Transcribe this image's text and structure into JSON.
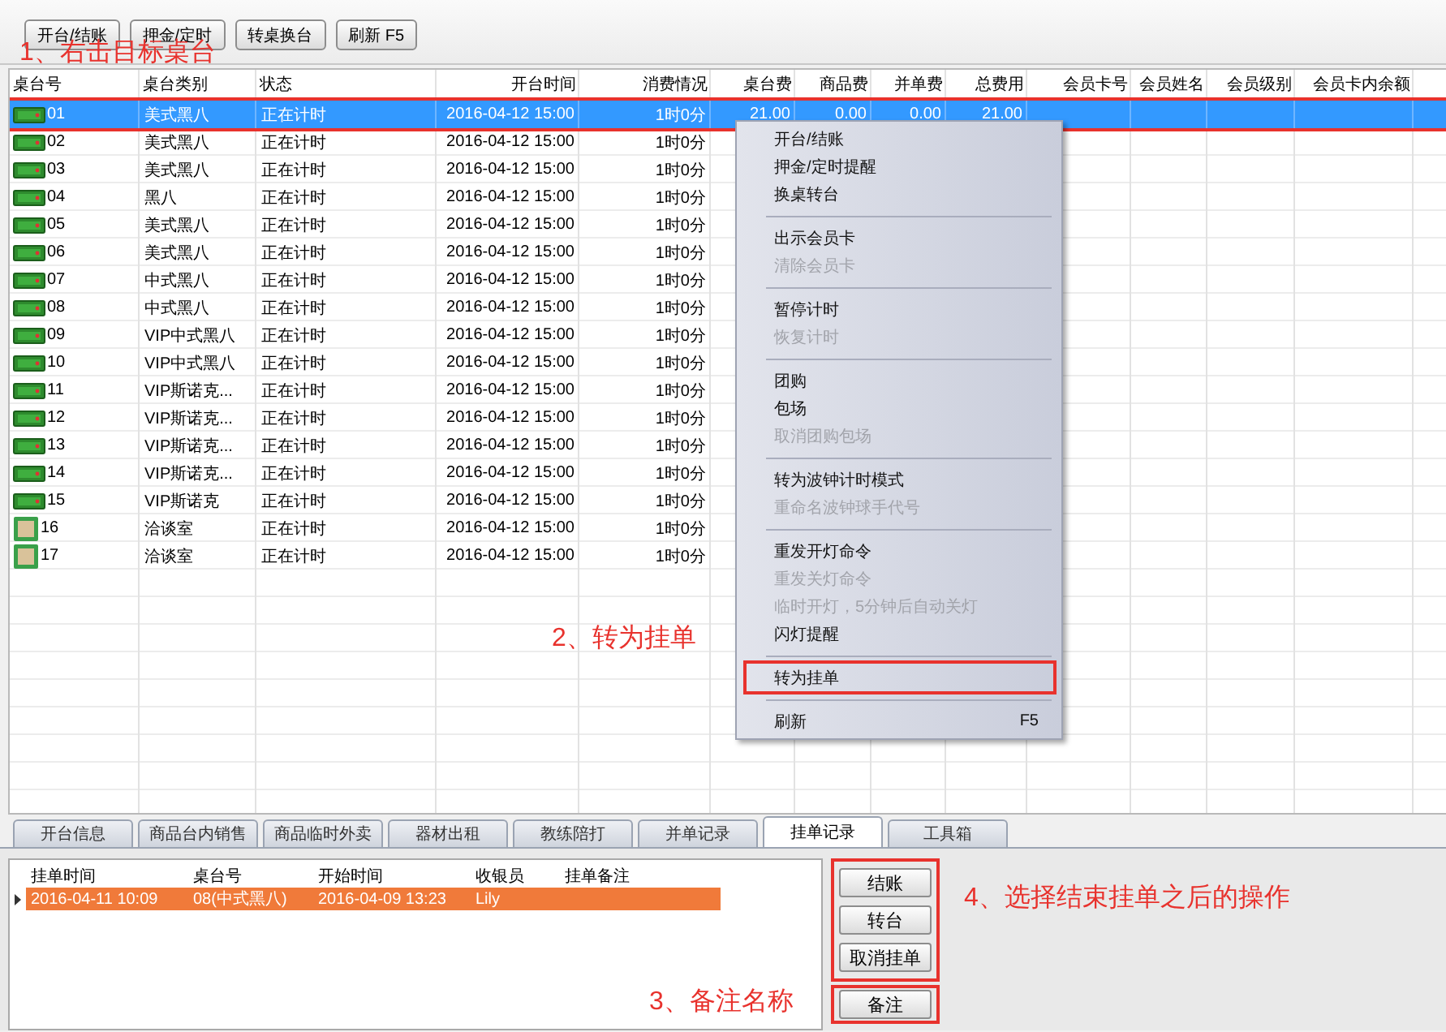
{
  "toolbar": {
    "buttons": [
      "开台/结账",
      "押金/定时",
      "转桌换台",
      "刷新 F5"
    ]
  },
  "tables": {
    "columns": [
      "桌台号",
      "桌台类别",
      "状态",
      "开台时间",
      "消费情况",
      "桌台费",
      "商品费",
      "并单费",
      "总费用",
      "会员卡号",
      "会员姓名",
      "会员级别",
      "会员卡内余额"
    ],
    "rows": [
      {
        "kind": "pool",
        "selected": true,
        "highlighted": true,
        "cells": [
          "01",
          "美式黑八",
          "正在计时",
          "2016-04-12 15:00",
          "1时0分",
          "21.00",
          "0.00",
          "0.00",
          "21.00"
        ]
      },
      {
        "kind": "pool",
        "selected": false,
        "highlighted": false,
        "cells": [
          "02",
          "美式黑八",
          "正在计时",
          "2016-04-12 15:00",
          "1时0分"
        ]
      },
      {
        "kind": "pool",
        "selected": false,
        "highlighted": false,
        "cells": [
          "03",
          "美式黑八",
          "正在计时",
          "2016-04-12 15:00",
          "1时0分"
        ]
      },
      {
        "kind": "pool",
        "selected": false,
        "highlighted": false,
        "cells": [
          "04",
          "黑八",
          "正在计时",
          "2016-04-12 15:00",
          "1时0分"
        ]
      },
      {
        "kind": "pool",
        "selected": false,
        "highlighted": false,
        "cells": [
          "05",
          "美式黑八",
          "正在计时",
          "2016-04-12 15:00",
          "1时0分"
        ]
      },
      {
        "kind": "pool",
        "selected": false,
        "highlighted": false,
        "cells": [
          "06",
          "美式黑八",
          "正在计时",
          "2016-04-12 15:00",
          "1时0分"
        ]
      },
      {
        "kind": "pool",
        "selected": false,
        "highlighted": false,
        "cells": [
          "07",
          "中式黑八",
          "正在计时",
          "2016-04-12 15:00",
          "1时0分"
        ]
      },
      {
        "kind": "pool",
        "selected": false,
        "highlighted": false,
        "cells": [
          "08",
          "中式黑八",
          "正在计时",
          "2016-04-12 15:00",
          "1时0分"
        ]
      },
      {
        "kind": "pool",
        "selected": false,
        "highlighted": false,
        "cells": [
          "09",
          "VIP中式黑八",
          "正在计时",
          "2016-04-12 15:00",
          "1时0分"
        ]
      },
      {
        "kind": "pool",
        "selected": false,
        "highlighted": false,
        "cells": [
          "10",
          "VIP中式黑八",
          "正在计时",
          "2016-04-12 15:00",
          "1时0分"
        ]
      },
      {
        "kind": "pool",
        "selected": false,
        "highlighted": false,
        "cells": [
          "11",
          "VIP斯诺克...",
          "正在计时",
          "2016-04-12 15:00",
          "1时0分"
        ]
      },
      {
        "kind": "pool",
        "selected": false,
        "highlighted": false,
        "cells": [
          "12",
          "VIP斯诺克...",
          "正在计时",
          "2016-04-12 15:00",
          "1时0分"
        ]
      },
      {
        "kind": "pool",
        "selected": false,
        "highlighted": false,
        "cells": [
          "13",
          "VIP斯诺克...",
          "正在计时",
          "2016-04-12 15:00",
          "1时0分"
        ]
      },
      {
        "kind": "pool",
        "selected": false,
        "highlighted": false,
        "cells": [
          "14",
          "VIP斯诺克...",
          "正在计时",
          "2016-04-12 15:00",
          "1时0分"
        ]
      },
      {
        "kind": "pool",
        "selected": false,
        "highlighted": false,
        "cells": [
          "15",
          "VIP斯诺克",
          "正在计时",
          "2016-04-12 15:00",
          "1时0分"
        ]
      },
      {
        "kind": "room",
        "selected": false,
        "highlighted": false,
        "cells": [
          "16",
          "洽谈室",
          "正在计时",
          "2016-04-12 15:00",
          "1时0分"
        ]
      },
      {
        "kind": "room",
        "selected": false,
        "highlighted": false,
        "cells": [
          "17",
          "洽谈室",
          "正在计时",
          "2016-04-12 15:00",
          "1时0分"
        ]
      }
    ]
  },
  "context_menu": {
    "items": [
      {
        "kind": "item",
        "label": "开台/结账",
        "disabled": false,
        "highlighted": false
      },
      {
        "kind": "item",
        "label": "押金/定时提醒",
        "disabled": false,
        "highlighted": false
      },
      {
        "kind": "item",
        "label": "换桌转台",
        "disabled": false,
        "highlighted": false
      },
      {
        "kind": "separator"
      },
      {
        "kind": "item",
        "label": "出示会员卡",
        "disabled": false,
        "highlighted": false
      },
      {
        "kind": "item",
        "label": "清除会员卡",
        "disabled": true,
        "highlighted": false
      },
      {
        "kind": "separator"
      },
      {
        "kind": "item",
        "label": "暂停计时",
        "disabled": false,
        "highlighted": false
      },
      {
        "kind": "item",
        "label": "恢复计时",
        "disabled": true,
        "highlighted": false
      },
      {
        "kind": "separator"
      },
      {
        "kind": "item",
        "label": "团购",
        "disabled": false,
        "highlighted": false
      },
      {
        "kind": "item",
        "label": "包场",
        "disabled": false,
        "highlighted": false
      },
      {
        "kind": "item",
        "label": "取消团购包场",
        "disabled": true,
        "highlighted": false
      },
      {
        "kind": "separator"
      },
      {
        "kind": "item",
        "label": "转为波钟计时模式",
        "disabled": false,
        "highlighted": false
      },
      {
        "kind": "item",
        "label": "重命名波钟球手代号",
        "disabled": true,
        "highlighted": false
      },
      {
        "kind": "separator"
      },
      {
        "kind": "item",
        "label": "重发开灯命令",
        "disabled": false,
        "highlighted": false
      },
      {
        "kind": "item",
        "label": "重发关灯命令",
        "disabled": true,
        "highlighted": false
      },
      {
        "kind": "item",
        "label": "临时开灯，5分钟后自动关灯",
        "disabled": true,
        "highlighted": false
      },
      {
        "kind": "item",
        "label": "闪灯提醒",
        "disabled": false,
        "highlighted": false
      },
      {
        "kind": "separator"
      },
      {
        "kind": "item",
        "label": "转为挂单",
        "disabled": false,
        "highlighted": true
      },
      {
        "kind": "separator"
      },
      {
        "kind": "item",
        "label": "刷新",
        "shortcut": "F5",
        "disabled": false,
        "highlighted": false
      }
    ]
  },
  "bottom_tabs": [
    {
      "label": "开台信息",
      "selected": false
    },
    {
      "label": "商品台内销售",
      "selected": false
    },
    {
      "label": "商品临时外卖",
      "selected": false
    },
    {
      "label": "器材出租",
      "selected": false
    },
    {
      "label": "教练陪打",
      "selected": false
    },
    {
      "label": "并单记录",
      "selected": false
    },
    {
      "label": "挂单记录",
      "selected": true
    },
    {
      "label": "工具箱",
      "selected": false
    }
  ],
  "hangup_list": {
    "columns": [
      "挂单时间",
      "桌台号",
      "开始时间",
      "收银员",
      "挂单备注"
    ],
    "rows": [
      {
        "selected": true,
        "cells": [
          "2016-04-11 10:09",
          "08(中式黑八)",
          "2016-04-09 13:23",
          "Lily"
        ]
      }
    ]
  },
  "actions": {
    "highlighted": true,
    "buttons": [
      "结账",
      "转台",
      "取消挂单"
    ]
  },
  "note_button": {
    "label": "备注",
    "highlighted": true
  },
  "annotations": [
    {
      "text": "1、右击目标桌台"
    },
    {
      "text": "2、转为挂单"
    },
    {
      "text": "3、备注名称"
    },
    {
      "text": "4、选择结束挂单之后的操作"
    }
  ]
}
